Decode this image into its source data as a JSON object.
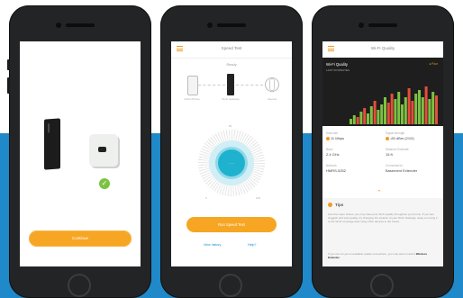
{
  "colors": {
    "accent": "#f6a623",
    "background_band": "#1f89c9",
    "quality_good": "#7cc242",
    "quality_poor": "#e74c3c"
  },
  "screen1": {
    "status_carrier": "•••••• Bell",
    "status_time": "9:41 AM",
    "status_battery": "100%",
    "title": "Add Wi-Fi Extender",
    "subtitle": "Which Wi-Fi Extender do you have?",
    "continue_label": "Continue"
  },
  "screen2": {
    "header_title": "Speed Test",
    "ready_label": "Ready",
    "node_phone": "Jodi's iPhone",
    "node_gateway": "Wi-Fi Gateway",
    "node_internet": "Internet",
    "tick_min": "0",
    "tick_mid": "50",
    "tick_max": "100",
    "dial_text": "- - -",
    "run_label": "Run Speed Test",
    "history_label": "View history",
    "help_label": "Help?"
  },
  "screen3": {
    "header_title": "Wi-Fi Quality",
    "graph_title": "Wi-Fi Quality",
    "graph_sub": "LAST 60 MINUTES",
    "legend": "Poor",
    "stats": [
      {
        "k": "Data rate",
        "v": "11 Mbps",
        "dot": true
      },
      {
        "k": "Signal strength",
        "v": "-83 dBm (2/10)",
        "dot": true
      },
      {
        "k": "Band",
        "v": "2.4 GHz",
        "dot": false
      },
      {
        "k": "Distance Estimate",
        "v": "15 ft",
        "dot": false
      },
      {
        "k": "Network",
        "v": "HMRS-5252",
        "dot": false
      },
      {
        "k": "Connected to",
        "v": "Basement Extender",
        "dot": false
      }
    ],
    "tips_title": "Tips",
    "tips_body": "Like the meter shows, you may have poor Wi-Fi quality throughout your home. If you feel sluggish and slow quality, try changing the location of your Wi-Fi Gateway, away a moving it to the Wi-Fi coverage area using other devices in the house.",
    "tips_body2": "If you are not yet an available quality somewhere, you may want to add a",
    "tips_bold": "Wireless Extender"
  }
}
